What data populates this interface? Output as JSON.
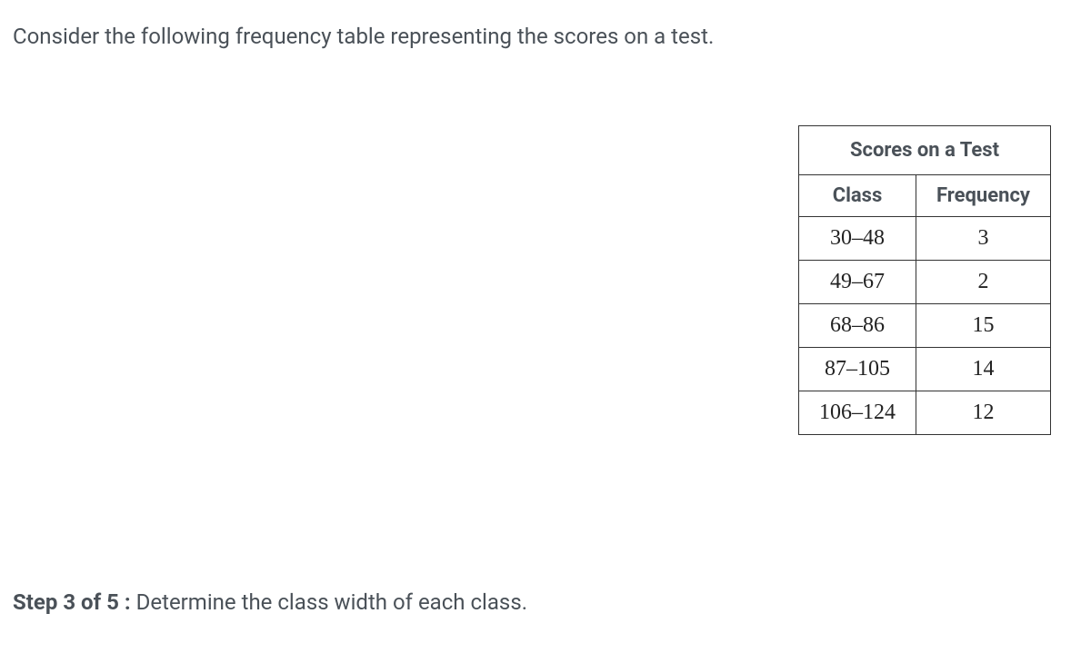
{
  "intro": "Consider the following frequency table representing the scores on a test.",
  "table": {
    "title": "Scores on a Test",
    "headers": {
      "class": "Class",
      "frequency": "Frequency"
    },
    "rows": [
      {
        "class": "30–48",
        "frequency": "3"
      },
      {
        "class": "49–67",
        "frequency": "2"
      },
      {
        "class": "68–86",
        "frequency": "15"
      },
      {
        "class": "87–105",
        "frequency": "14"
      },
      {
        "class": "106–124",
        "frequency": "12"
      }
    ]
  },
  "step": {
    "label": "Step 3 of 5 :",
    "instruction": "  Determine the class width of each class."
  }
}
